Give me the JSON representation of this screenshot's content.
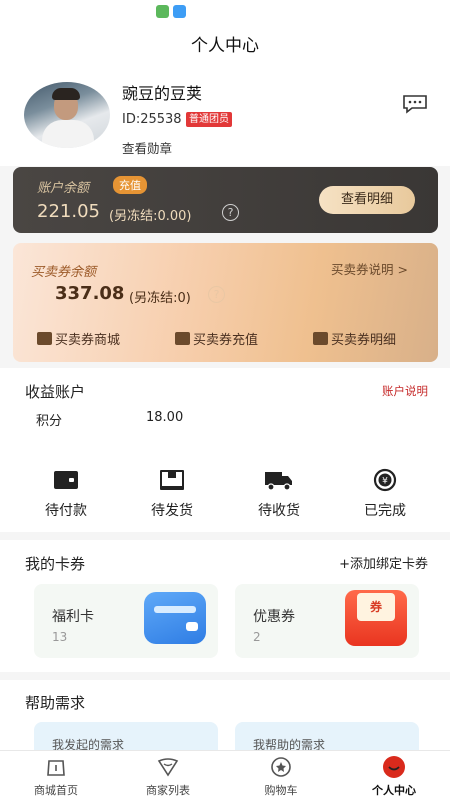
{
  "header": {
    "title": "个人中心"
  },
  "profile": {
    "nickname": "豌豆的豆荚",
    "id_text": "ID:25538",
    "member_level": "普通团员",
    "badge_link": "查看勋章"
  },
  "account": {
    "label": "账户余额",
    "recharge_label": "充值",
    "balance": "221.05",
    "frozen_text": "(另冻结:0.00)",
    "detail_button": "查看明细"
  },
  "voucher": {
    "label": "买卖券余额",
    "balance": "337.08",
    "frozen_text": "(另冻结:0)",
    "explain_link": "买卖券说明 >",
    "actions": [
      "买卖券商城",
      "买卖券充值",
      "买卖券明细"
    ]
  },
  "earnings": {
    "title": "收益账户",
    "explain_link": "账户说明",
    "points_label": "积分",
    "points_value": "18.00"
  },
  "orders": {
    "items": [
      {
        "label": "待付款",
        "icon": "wallet-icon"
      },
      {
        "label": "待发货",
        "icon": "box-icon"
      },
      {
        "label": "待收货",
        "icon": "truck-icon"
      },
      {
        "label": "已完成",
        "icon": "yuan-refresh-icon"
      }
    ]
  },
  "cards": {
    "title": "我的卡券",
    "add_link": "+添加绑定卡券",
    "items": [
      {
        "name": "福利卡",
        "count": "13",
        "icon": "card-icon"
      },
      {
        "name": "优惠券",
        "count": "2",
        "icon": "coupon-icon",
        "icon_text": "券"
      }
    ]
  },
  "help": {
    "title": "帮助需求",
    "tiles": [
      "我发起的需求",
      "我帮助的需求"
    ]
  },
  "tabbar": {
    "tabs": [
      {
        "label": "商城首页",
        "icon": "home-icon"
      },
      {
        "label": "商家列表",
        "icon": "heart-icon"
      },
      {
        "label": "购物车",
        "icon": "cart-icon"
      },
      {
        "label": "个人中心",
        "icon": "profile-icon"
      }
    ],
    "active_index": 3
  },
  "colors": {
    "accent_red": "#e23838",
    "dark_card": "#3f3b39",
    "gold_text": "#f0dcbd",
    "voucher_gradient": "#f7cfae"
  }
}
